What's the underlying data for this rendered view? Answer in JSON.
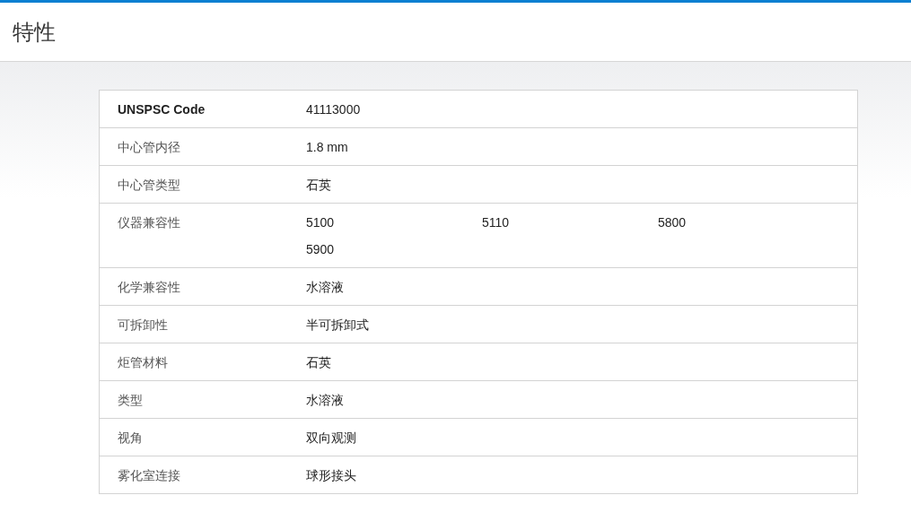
{
  "page_title": "特性",
  "properties": [
    {
      "kind": "emphasized",
      "label": "UNSPSC Code",
      "values": [
        "41113000"
      ]
    },
    {
      "kind": "plain",
      "label": "中心管内径",
      "values": [
        "1.8 mm"
      ]
    },
    {
      "kind": "plain",
      "label": "中心管类型",
      "values": [
        "石英"
      ]
    },
    {
      "kind": "plain",
      "label": "仪器兼容性",
      "values": [
        "5100",
        "5110",
        "5800",
        "5900"
      ]
    },
    {
      "kind": "plain",
      "label": "化学兼容性",
      "values": [
        "水溶液"
      ]
    },
    {
      "kind": "plain",
      "label": "可拆卸性",
      "values": [
        "半可拆卸式"
      ]
    },
    {
      "kind": "plain",
      "label": "炬管材料",
      "values": [
        "石英"
      ]
    },
    {
      "kind": "plain",
      "label": "类型",
      "values": [
        "水溶液"
      ]
    },
    {
      "kind": "plain",
      "label": "视角",
      "values": [
        "双向观测"
      ]
    },
    {
      "kind": "plain",
      "label": "雾化室连接",
      "values": [
        "球形接头"
      ]
    }
  ]
}
